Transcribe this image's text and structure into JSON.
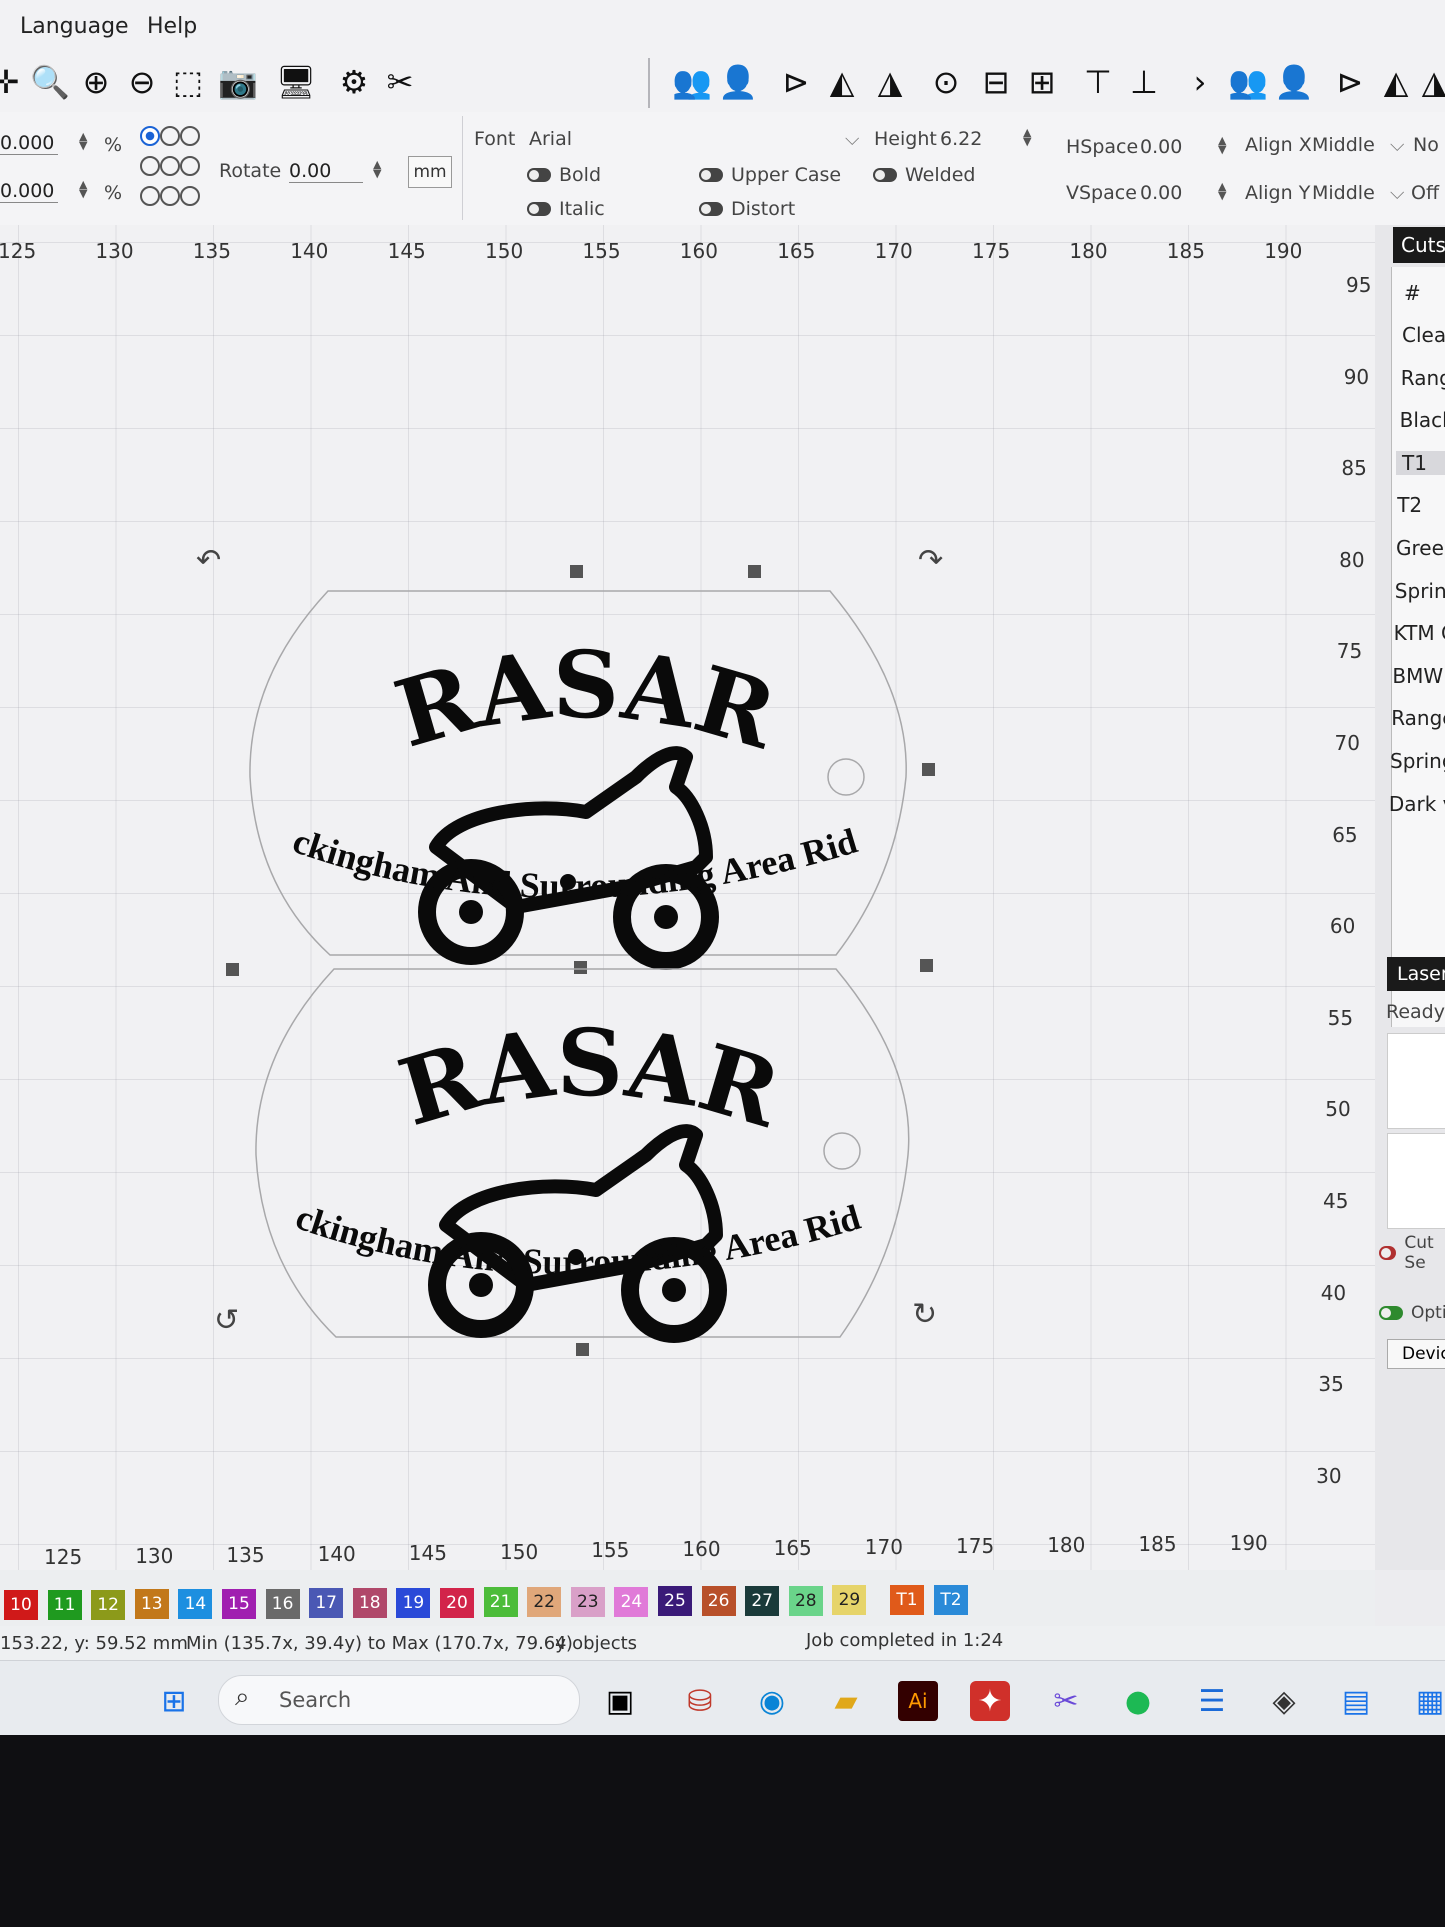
{
  "menu": [
    "Language",
    "Help"
  ],
  "props": {
    "x_value": "0.000",
    "y_value": "0.000",
    "percent": "%",
    "rotate_label": "Rotate",
    "rotate_value": "0.00",
    "unit_button": "mm",
    "font_label": "Font",
    "font_value": "Arial",
    "height_label": "Height",
    "height_value": "6.22",
    "bold_label": "Bold",
    "italic_label": "Italic",
    "upper_case_label": "Upper Case",
    "distort_label": "Distort",
    "welded_label": "Welded",
    "hspace_label": "HSpace",
    "hspace_value": "0.00",
    "vspace_label": "VSpace",
    "vspace_value": "0.00",
    "align_x_label": "Align X",
    "align_x_value": "Middle",
    "align_y_label": "Align Y",
    "align_y_value": "Middle",
    "extra_1": "No",
    "extra_2": "Off"
  },
  "ruler_top": [
    "125",
    "130",
    "135",
    "140",
    "145",
    "150",
    "155",
    "160",
    "165",
    "170",
    "175",
    "180",
    "185",
    "190"
  ],
  "ruler_bottom": [
    "125",
    "130",
    "135",
    "140",
    "145",
    "150",
    "155",
    "160",
    "165",
    "170",
    "175",
    "180",
    "185",
    "190"
  ],
  "ruler_right": [
    "95",
    "90",
    "85",
    "80",
    "75",
    "70",
    "65",
    "60",
    "55",
    "50",
    "45",
    "40",
    "35",
    "30"
  ],
  "design": {
    "title": "RASAR",
    "subtitle": "Rockingham And Surrounding Area Riders"
  },
  "cuts_panel": {
    "tab": "Cuts",
    "header": "#",
    "items": [
      "Clear",
      "Range",
      "Black",
      "T1",
      "T2",
      "Green",
      "Spring",
      "KTM C",
      "BMW T",
      "Ranger",
      "Springl",
      "Dark ve"
    ]
  },
  "laser_panel": {
    "tab": "Laser",
    "status": "Ready",
    "cut_selected": "Cut Se",
    "optimize": "Optimi",
    "devices": "Devices"
  },
  "palette": [
    {
      "label": "10",
      "color": "#d01919"
    },
    {
      "label": "11",
      "color": "#1f9a1f"
    },
    {
      "label": "12",
      "color": "#8c9a1a"
    },
    {
      "label": "13",
      "color": "#c2781a"
    },
    {
      "label": "14",
      "color": "#1d8fe0"
    },
    {
      "label": "15",
      "color": "#a01fb0"
    },
    {
      "label": "16",
      "color": "#6a6a6a"
    },
    {
      "label": "17",
      "color": "#4a58b4"
    },
    {
      "label": "18",
      "color": "#b0486a"
    },
    {
      "label": "19",
      "color": "#2a4ad8"
    },
    {
      "label": "20",
      "color": "#d2244a"
    },
    {
      "label": "21",
      "color": "#4cbc3a"
    },
    {
      "label": "22",
      "color": "#e0a77a"
    },
    {
      "label": "23",
      "color": "#d9a0c8"
    },
    {
      "label": "24",
      "color": "#e07ad8"
    },
    {
      "label": "25",
      "color": "#3a1a78"
    },
    {
      "label": "26",
      "color": "#b8502a"
    },
    {
      "label": "27",
      "color": "#1a3a3a"
    },
    {
      "label": "28",
      "color": "#6ad48a"
    },
    {
      "label": "29",
      "color": "#e6d46a"
    },
    {
      "label": "T1",
      "color": "#e05a1a"
    },
    {
      "label": "T2",
      "color": "#2a8ad8"
    }
  ],
  "status": {
    "coords": "153.22, y: 59.52 mm",
    "bounds": "Min (135.7x, 39.4y) to Max (170.7x, 79.6y)",
    "objects": "4 objects",
    "job": "Job completed in 1:24"
  },
  "taskbar": {
    "search_placeholder": "Search"
  },
  "colors": {
    "selection": "#1a63d6",
    "ink": "#0a0a0a"
  }
}
